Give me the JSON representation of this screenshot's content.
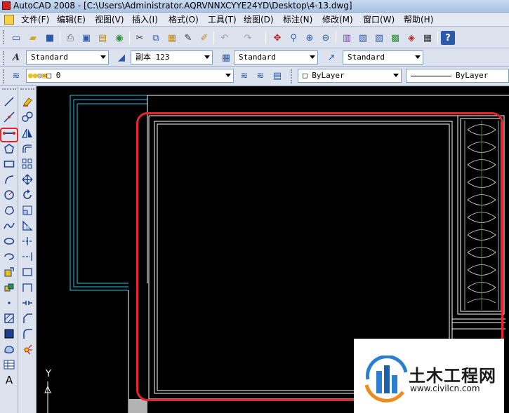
{
  "window": {
    "title": "AutoCAD 2008 - [C:\\Users\\Administrator.AQRVNNXCYYE24YD\\Desktop\\4-13.dwg]"
  },
  "menu": {
    "items": [
      "文件(F)",
      "编辑(E)",
      "视图(V)",
      "插入(I)",
      "格式(O)",
      "工具(T)",
      "绘图(D)",
      "标注(N)",
      "修改(M)",
      "窗口(W)",
      "帮助(H)"
    ]
  },
  "styles_toolbar": {
    "text_style": "Standard",
    "dim_style": "副本 123",
    "table_style": "Standard",
    "multileader_style": "Standard"
  },
  "layers_toolbar": {
    "current_layer": "0",
    "color": "ByLayer",
    "linetype": "ByLayer"
  },
  "ucs": {
    "y_label": "Y"
  },
  "watermark": {
    "title": "土木工程网",
    "url": "www.civilcn.com"
  },
  "colors": {
    "highlight": "#e5262a",
    "cyan_lines": "#19c8e8",
    "drawing_lines": "#ffffff",
    "canvas": "#000000"
  }
}
